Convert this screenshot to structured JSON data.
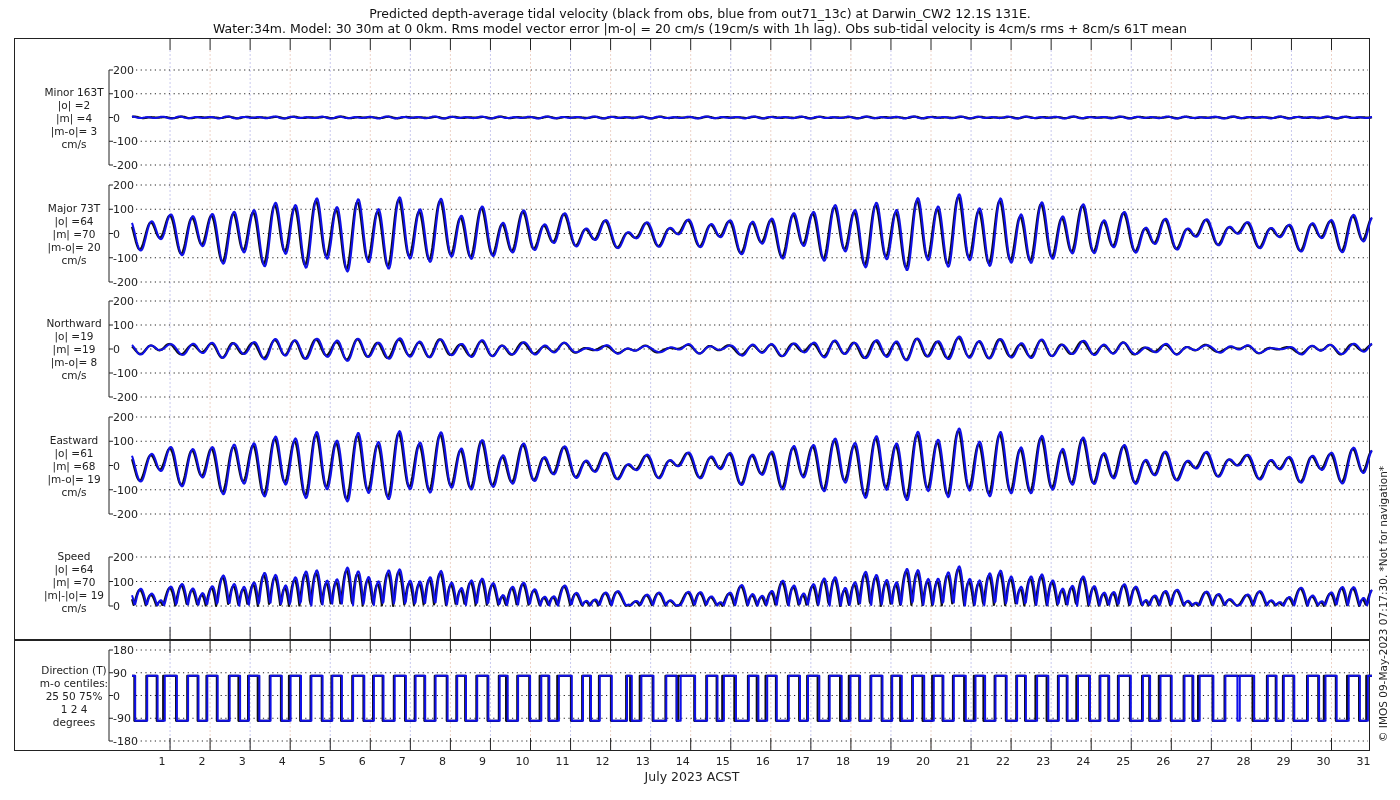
{
  "title_lines": [
    "Predicted depth-average tidal velocity (black from obs, blue from out71_13c) at Darwin_CW2 12.1S 131E.",
    "Water:34m. Model: 30 30m at 0 0km. Rms model vector error |m-o| = 20 cm/s (19cm/s with 1h lag). Obs sub-tidal velocity is 4cm/s rms + 8cm/s 61T mean"
  ],
  "panels": [
    {
      "kind": "minor",
      "label_lines": [
        "Minor 163T",
        "|o| =2",
        "|m| =4",
        "|m-o|= 3",
        "cm/s"
      ],
      "yticks": [
        "200",
        "100",
        "0",
        "-100",
        "-200"
      ]
    },
    {
      "kind": "major",
      "label_lines": [
        "Major 73T",
        "|o| =64",
        "|m| =70",
        "|m-o|= 20",
        "cm/s"
      ],
      "yticks": [
        "200",
        "100",
        "0",
        "-100",
        "-200"
      ]
    },
    {
      "kind": "northward",
      "label_lines": [
        "Northward",
        "|o| =19",
        "|m| =19",
        "|m-o|= 8",
        "cm/s"
      ],
      "yticks": [
        "200",
        "100",
        "0",
        "-100",
        "-200"
      ]
    },
    {
      "kind": "eastward",
      "label_lines": [
        "Eastward",
        "|o| =61",
        "|m| =68",
        "|m-o|= 19",
        "cm/s"
      ],
      "yticks": [
        "200",
        "100",
        "0",
        "-100",
        "-200"
      ]
    },
    {
      "kind": "speed",
      "label_lines": [
        "Speed",
        "|o| =64",
        "|m| =70",
        "|m|-|o|= 19",
        "cm/s"
      ],
      "yticks": [
        "200",
        "100",
        "0"
      ]
    },
    {
      "kind": "direction",
      "label_lines": [
        "Direction (T)",
        "m-o centiles:",
        "25  50  75%",
        "1  2  4",
        "degrees"
      ],
      "yticks": [
        "180",
        "90",
        "0",
        "-90",
        "-180"
      ]
    }
  ],
  "x_ticks": [
    "1",
    "2",
    "3",
    "4",
    "5",
    "6",
    "7",
    "8",
    "9",
    "10",
    "11",
    "12",
    "13",
    "14",
    "15",
    "16",
    "17",
    "18",
    "19",
    "20",
    "21",
    "22",
    "23",
    "24",
    "25",
    "26",
    "27",
    "28",
    "29",
    "30",
    "31"
  ],
  "x_axis_label": "July 2023 ACST",
  "credit": "© IMOS 09-May-2023 07:17:30. *Not for navigation*"
}
